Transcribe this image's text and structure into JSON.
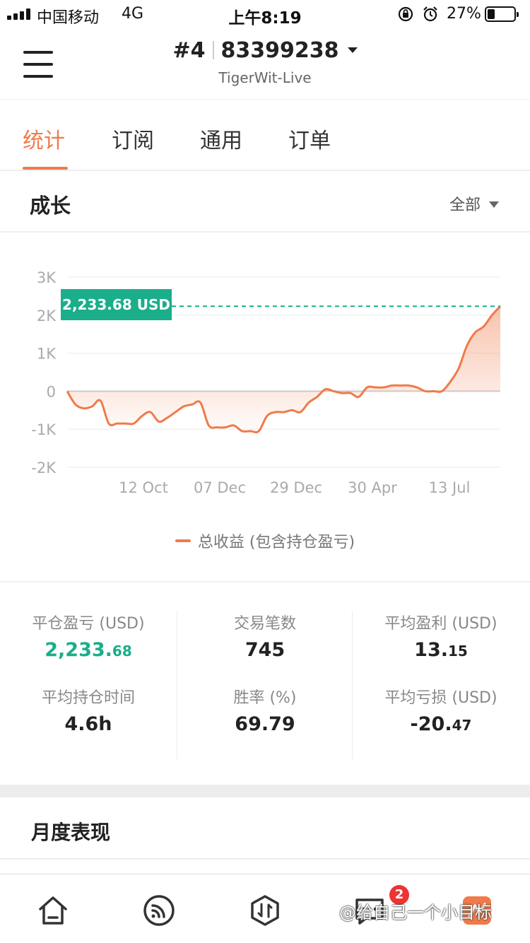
{
  "status_bar": {
    "carrier": "中国移动",
    "network": "4G",
    "time": "上午8:19",
    "battery_pct": "27%",
    "icons": [
      "signal-icon",
      "rotation-lock-icon",
      "alarm-icon",
      "battery-icon"
    ]
  },
  "header": {
    "account_number": "#4",
    "account_id": "83399238",
    "server": "TigerWit-Live",
    "menu_icon": "hamburger-menu-icon",
    "dropdown_icon": "caret-down-icon"
  },
  "tabs": [
    {
      "label": "统计",
      "active": true
    },
    {
      "label": "订阅",
      "active": false
    },
    {
      "label": "通用",
      "active": false
    },
    {
      "label": "订单",
      "active": false
    }
  ],
  "growth": {
    "title": "成长",
    "range_label": "全部"
  },
  "chart_data": {
    "type": "area",
    "current_value_label": "2,233.68 USD",
    "y_tick_labels": [
      "3K",
      "2K",
      "1K",
      "0",
      "-1K",
      "-2K"
    ],
    "ylim": [
      -2000,
      3000
    ],
    "x_tick_labels": [
      "12 Oct",
      "07 Dec",
      "29 Dec",
      "30 Apr",
      "13 Jul"
    ],
    "series": [
      {
        "name": "总收益 (包含持仓盈亏)",
        "color": "#f07a4a",
        "values": [
          0,
          -350,
          -450,
          -400,
          -250,
          -850,
          -850,
          -850,
          -850,
          -650,
          -550,
          -800,
          -700,
          -550,
          -400,
          -350,
          -300,
          -900,
          -950,
          -950,
          -900,
          -1050,
          -1050,
          -1050,
          -650,
          -550,
          -550,
          -500,
          -550,
          -300,
          -150,
          50,
          0,
          -50,
          -50,
          -150,
          100,
          100,
          100,
          150,
          150,
          150,
          100,
          0,
          0,
          0,
          250,
          600,
          1200,
          1550,
          1700,
          2000,
          2233.68
        ]
      }
    ],
    "grid": true,
    "legend_position": "bottom-center",
    "marker_color": "#1aae8b"
  },
  "stats": [
    {
      "label": "平仓盈亏 (USD)",
      "int": "2,233.",
      "dec": "68",
      "highlight": true
    },
    {
      "label": "交易笔数",
      "int": "745",
      "dec": "",
      "highlight": false
    },
    {
      "label": "平均盈利 (USD)",
      "int": "13.",
      "dec": "15",
      "highlight": false
    },
    {
      "label": "平均持仓时间",
      "int": "4.6h",
      "dec": "",
      "highlight": false
    },
    {
      "label": "胜率 (%)",
      "int": "69.79",
      "dec": "",
      "highlight": false
    },
    {
      "label": "平均亏损 (USD)",
      "int": "-20.",
      "dec": "47",
      "highlight": false
    }
  ],
  "monthly": {
    "title": "月度表现"
  },
  "bottom_nav": {
    "items": [
      {
        "icon": "home-icon"
      },
      {
        "icon": "feed-icon"
      },
      {
        "icon": "trade-icon"
      },
      {
        "icon": "messages-icon"
      },
      {
        "icon": "profile-icon"
      }
    ],
    "message_badge": "2",
    "watermark": "@给自己一个小目标"
  }
}
